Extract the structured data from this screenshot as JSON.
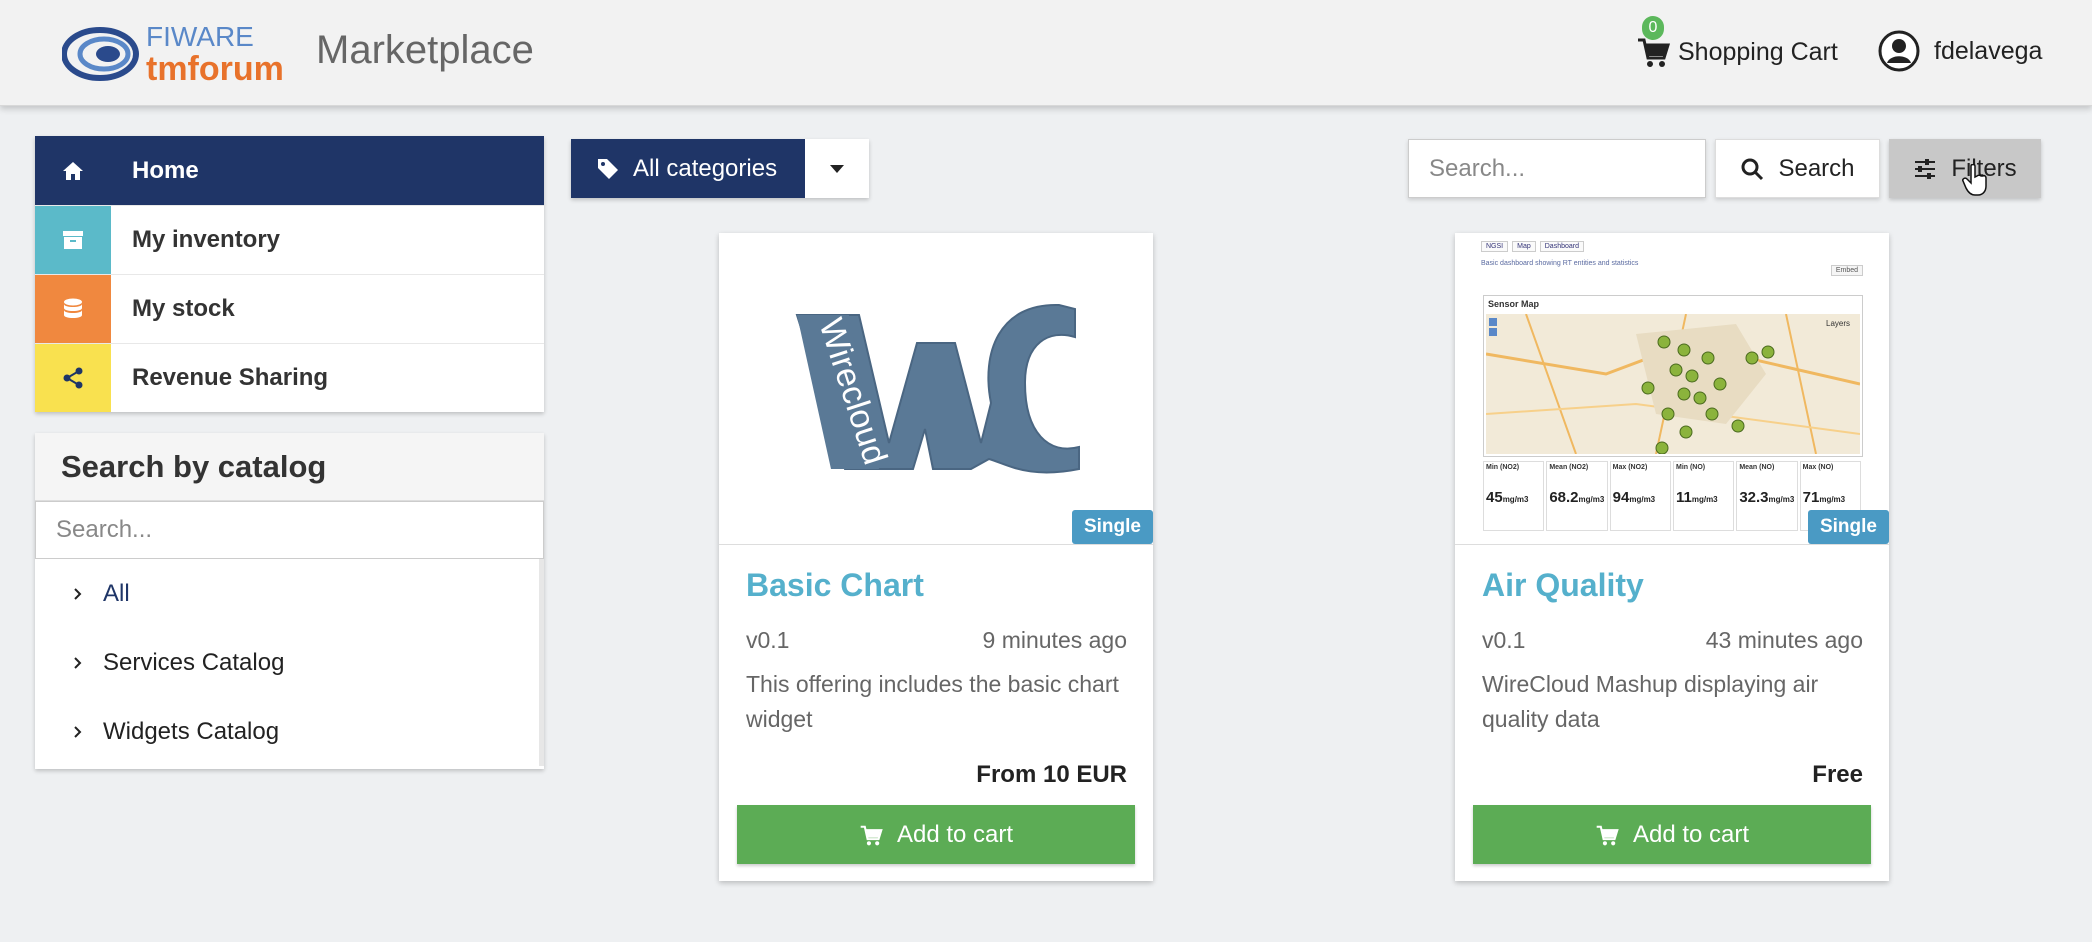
{
  "header": {
    "logo_top": "FIWARE",
    "logo_bottom": "tmforum",
    "brand": "Marketplace",
    "cart_label": "Shopping Cart",
    "cart_count": "0",
    "username": "fdelavega"
  },
  "sidebar": {
    "items": [
      {
        "label": "Home",
        "icon": "home-icon"
      },
      {
        "label": "My inventory",
        "icon": "archive-icon"
      },
      {
        "label": "My stock",
        "icon": "database-icon"
      },
      {
        "label": "Revenue Sharing",
        "icon": "share-icon"
      }
    ]
  },
  "catalog": {
    "title": "Search by catalog",
    "search_placeholder": "Search...",
    "items": [
      "All",
      "Services Catalog",
      "Widgets Catalog"
    ]
  },
  "toolbar": {
    "categories_label": "All categories",
    "search_placeholder": "Search...",
    "search_label": "Search",
    "filters_label": "Filters"
  },
  "cards": [
    {
      "title": "Basic Chart",
      "version": "v0.1",
      "time": "9 minutes ago",
      "description": "This offering includes the basic chart widget",
      "price": "From 10 EUR",
      "badge": "Single",
      "button": "Add to cart",
      "logo_text": "Wirecloud"
    },
    {
      "title": "Air Quality",
      "version": "v0.1",
      "time": "43 minutes ago",
      "description": "WireCloud Mashup displaying air quality data",
      "price": "Free",
      "badge": "Single",
      "button": "Add to cart",
      "dashboard": {
        "tabs": [
          "NGSI",
          "Map",
          "Dashboard"
        ],
        "subtitle": "Basic dashboard showing RT entities and statistics",
        "embed": "Embed",
        "map_title": "Sensor Map",
        "map_layers": "Layers",
        "stats": [
          {
            "label": "Min (NO2)",
            "value": "45",
            "unit": "mg/m3"
          },
          {
            "label": "Mean (NO2)",
            "value": "68.2",
            "unit": "mg/m3"
          },
          {
            "label": "Max (NO2)",
            "value": "94",
            "unit": "mg/m3"
          },
          {
            "label": "Min (NO)",
            "value": "11",
            "unit": "mg/m3"
          },
          {
            "label": "Mean (NO)",
            "value": "32.3",
            "unit": "mg/m3"
          },
          {
            "label": "Max (NO)",
            "value": "71",
            "unit": "mg/m3"
          }
        ]
      }
    }
  ],
  "colors": {
    "nav_active": "#1f3567",
    "inventory": "#5bbac9",
    "stock": "#f0883f",
    "revenue": "#f9e14f",
    "add_button": "#5cac55",
    "title_link": "#55b0cc",
    "badge": "#4a9ac4"
  }
}
